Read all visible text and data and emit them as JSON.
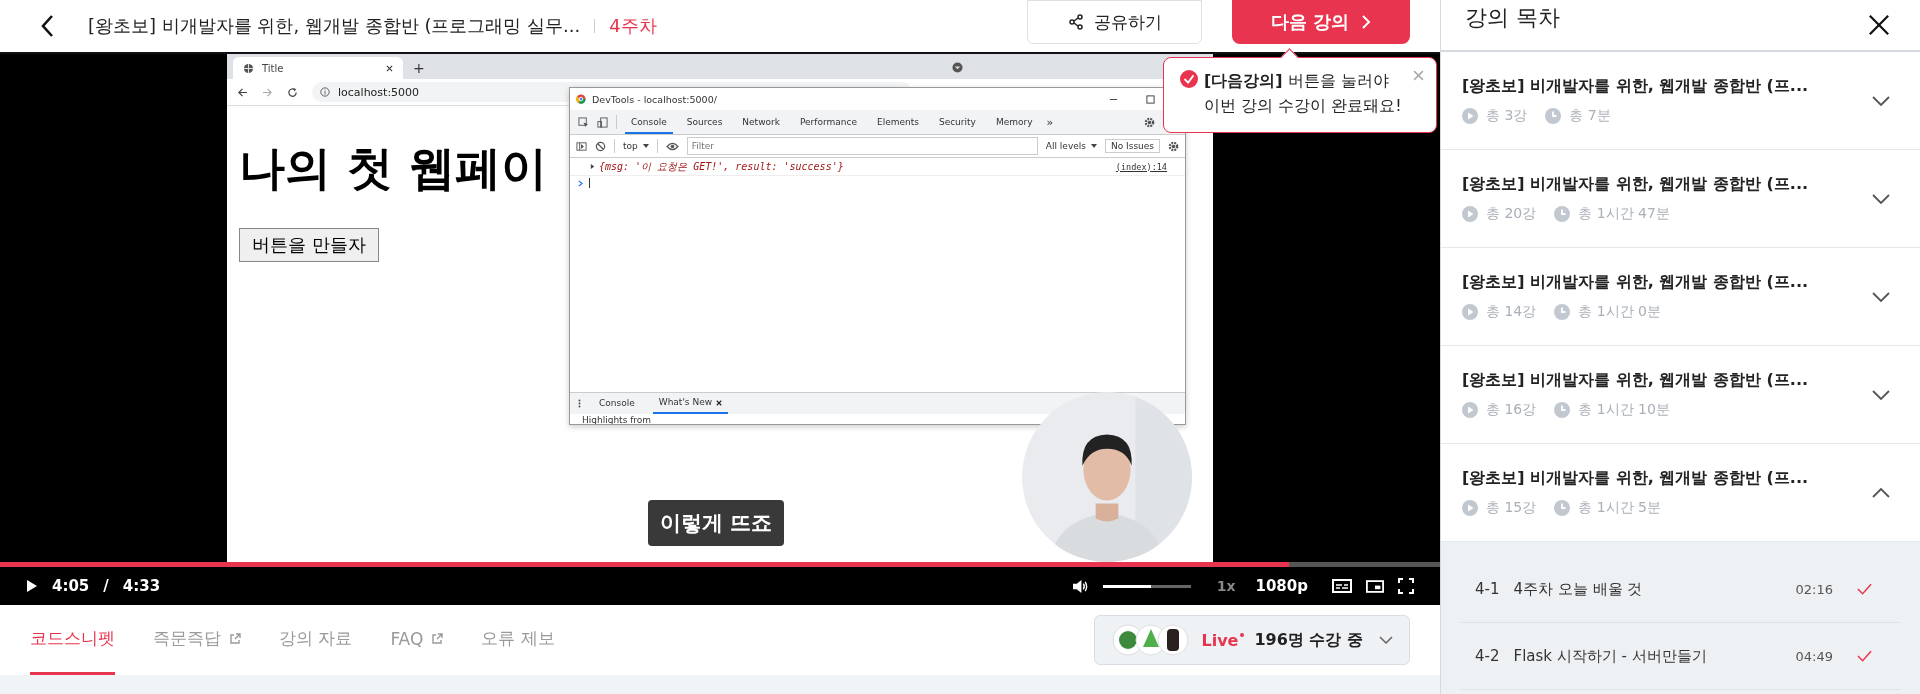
{
  "header": {
    "title": "[왕초보] 비개발자를 위한, 웹개발 종합반 (프로그래밍 실무...",
    "week": "4주차",
    "share_button": "공유하기",
    "next_button": "다음 강의"
  },
  "tooltip": {
    "lines": [
      "**[다음강의]** 버튼을 눌러야",
      "이번 강의 수강이 완료돼요!"
    ]
  },
  "video": {
    "browser": {
      "tab_title": "Title",
      "new_tab": "+",
      "url": "localhost:5000",
      "heading": "나의 첫 웹페이",
      "button": "버튼을 만들자"
    },
    "devtools": {
      "title": "DevTools - localhost:5000/",
      "tabs": [
        {
          "label": "Console",
          "selected": true
        },
        {
          "label": "Sources",
          "selected": false
        },
        {
          "label": "Network",
          "selected": false
        },
        {
          "label": "Performance",
          "selected": false
        },
        {
          "label": "Elements",
          "selected": false
        },
        {
          "label": "Security",
          "selected": false
        },
        {
          "label": "Memory",
          "selected": false
        }
      ],
      "more": "»",
      "context": "top",
      "filter_placeholder": "Filter",
      "levels": "All levels",
      "issues": "No Issues",
      "log": {
        "text": "{msg: '이 요청은 GET!', result: 'success'}",
        "source": "(index):14"
      },
      "drawer_tabs": [
        {
          "label": "Console",
          "selected": false
        },
        {
          "label": "What's New",
          "selected": true
        }
      ],
      "drawer_text": "Highlights from"
    },
    "caption": "이렇게 뜨죠",
    "progress": {
      "level": 0.895
    },
    "current_time": "4:05",
    "separator": "/",
    "total_time": "4:33",
    "volume": {
      "level": 0.55
    },
    "speed": "1x",
    "quality": "1080p"
  },
  "tabs": [
    {
      "label": "코드스니펫",
      "selected": true,
      "external": false
    },
    {
      "label": "즉문즉답",
      "selected": false,
      "external": true
    },
    {
      "label": "강의 자료",
      "selected": false,
      "external": false
    },
    {
      "label": "FAQ",
      "selected": false,
      "external": true
    },
    {
      "label": "오류 제보",
      "selected": false,
      "external": false
    }
  ],
  "live": {
    "label": "Live",
    "count": "196명 수강 중"
  },
  "sidebar": {
    "title": "강의 목차",
    "sections": [
      {
        "title": "[왕초보] 비개발자를 위한, 웹개발 종합반 (프...",
        "lessons": "총 3강",
        "duration": "총 7분",
        "expanded": false
      },
      {
        "title": "[왕초보] 비개발자를 위한, 웹개발 종합반 (프...",
        "lessons": "총 20강",
        "duration": "총 1시간 47분",
        "expanded": false
      },
      {
        "title": "[왕초보] 비개발자를 위한, 웹개발 종합반 (프...",
        "lessons": "총 14강",
        "duration": "총 1시간 0분",
        "expanded": false
      },
      {
        "title": "[왕초보] 비개발자를 위한, 웹개발 종합반 (프...",
        "lessons": "총 16강",
        "duration": "총 1시간 10분",
        "expanded": false
      },
      {
        "title": "[왕초보] 비개발자를 위한, 웹개발 종합반 (프...",
        "lessons": "총 15강",
        "duration": "총 1시간 5분",
        "expanded": true,
        "items": [
          {
            "number": "4-1",
            "title": "4주차 오늘 배울 것",
            "time": "02:16",
            "done": true
          },
          {
            "number": "4-2",
            "title": "Flask 시작하기 - 서버만들기",
            "time": "04:49",
            "done": true
          }
        ]
      }
    ]
  }
}
